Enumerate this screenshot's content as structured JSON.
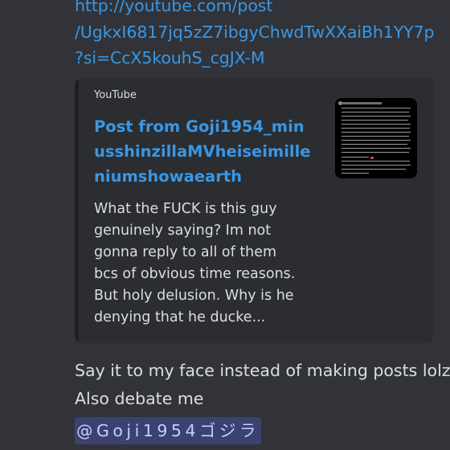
{
  "message": {
    "link_lines": [
      "http://youtube.com/post",
      "/UgkxI6817jq5zZ7ibgyChwdTwXXaiBh1YY7p",
      "?si=CcX5kouhS_cgJX-M"
    ],
    "embed": {
      "provider": "YouTube",
      "title_lines": [
        "Post from Goji1954_min",
        "usshinzillaMVheiseimille",
        "niumshowaearth"
      ],
      "description_lines": [
        "What the FUCK is this guy",
        "genuinely saying? Im not",
        "gonna reply to all of them",
        "bcs of obvious time reasons.",
        "But holy delusion. Why is he",
        "denying that he ducke..."
      ],
      "thumbnail_icon": "post-screenshot-thumbnail"
    },
    "text_lines": [
      "Say it to my face instead of making posts lolz",
      "Also debate me"
    ],
    "mention": "@Goji1954ゴジラ"
  },
  "colors": {
    "background": "#313338",
    "embed_background": "#2b2d31",
    "link": "#3a97e4",
    "text": "#dbdee1",
    "mention_background": "#3c4270",
    "mention_text": "#c9cdfb"
  }
}
